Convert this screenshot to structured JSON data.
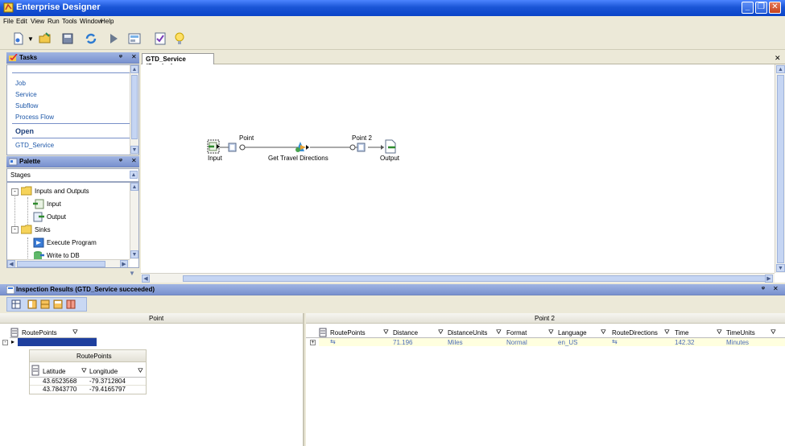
{
  "window": {
    "title": "Enterprise Designer"
  },
  "menu": [
    "File",
    "Edit",
    "View",
    "Run",
    "Tools",
    "Window",
    "Help"
  ],
  "tasks": {
    "title": "Tasks",
    "items": [
      "Job",
      "Service",
      "Subflow",
      "Process Flow"
    ],
    "open_label": "Open",
    "open_items": [
      "GTD_Service"
    ]
  },
  "palette": {
    "title": "Palette",
    "stages_label": "Stages",
    "tree": [
      {
        "label": "Inputs and Outputs",
        "type": "folder"
      },
      {
        "label": "Input",
        "type": "input"
      },
      {
        "label": "Output",
        "type": "output"
      },
      {
        "label": "Sinks",
        "type": "folder"
      },
      {
        "label": "Execute Program",
        "type": "exec"
      },
      {
        "label": "Write to DB",
        "type": "db"
      }
    ]
  },
  "canvas": {
    "tab_label": "GTD_Service (Service)",
    "nodes": {
      "input": "Input",
      "point": "Point",
      "directions": "Get Travel Directions",
      "point2": "Point 2",
      "output": "Output"
    }
  },
  "inspection": {
    "title": "Inspection Results (GTD_Service succeeded)",
    "left": {
      "header": "Point",
      "column": "RoutePoints",
      "nested_title": "RoutePoints",
      "nested_columns": [
        "Latitude",
        "Longitude"
      ],
      "rows": [
        [
          "43.6523568",
          "-79.3712804"
        ],
        [
          "43.7843770",
          "-79.4165797"
        ]
      ]
    },
    "right": {
      "header": "Point 2",
      "columns": [
        "RoutePoints",
        "Distance",
        "DistanceUnits",
        "Format",
        "Language",
        "RouteDirections",
        "Time",
        "TimeUnits"
      ],
      "row": [
        "",
        "71.196",
        "Miles",
        "Normal",
        "en_US",
        "",
        "142.32",
        "Minutes"
      ]
    }
  },
  "colors": {
    "titlebar": "#1a55d6",
    "panel_header": "#8ea4da",
    "link": "#1d57a8",
    "selection": "#1e3f9e"
  }
}
